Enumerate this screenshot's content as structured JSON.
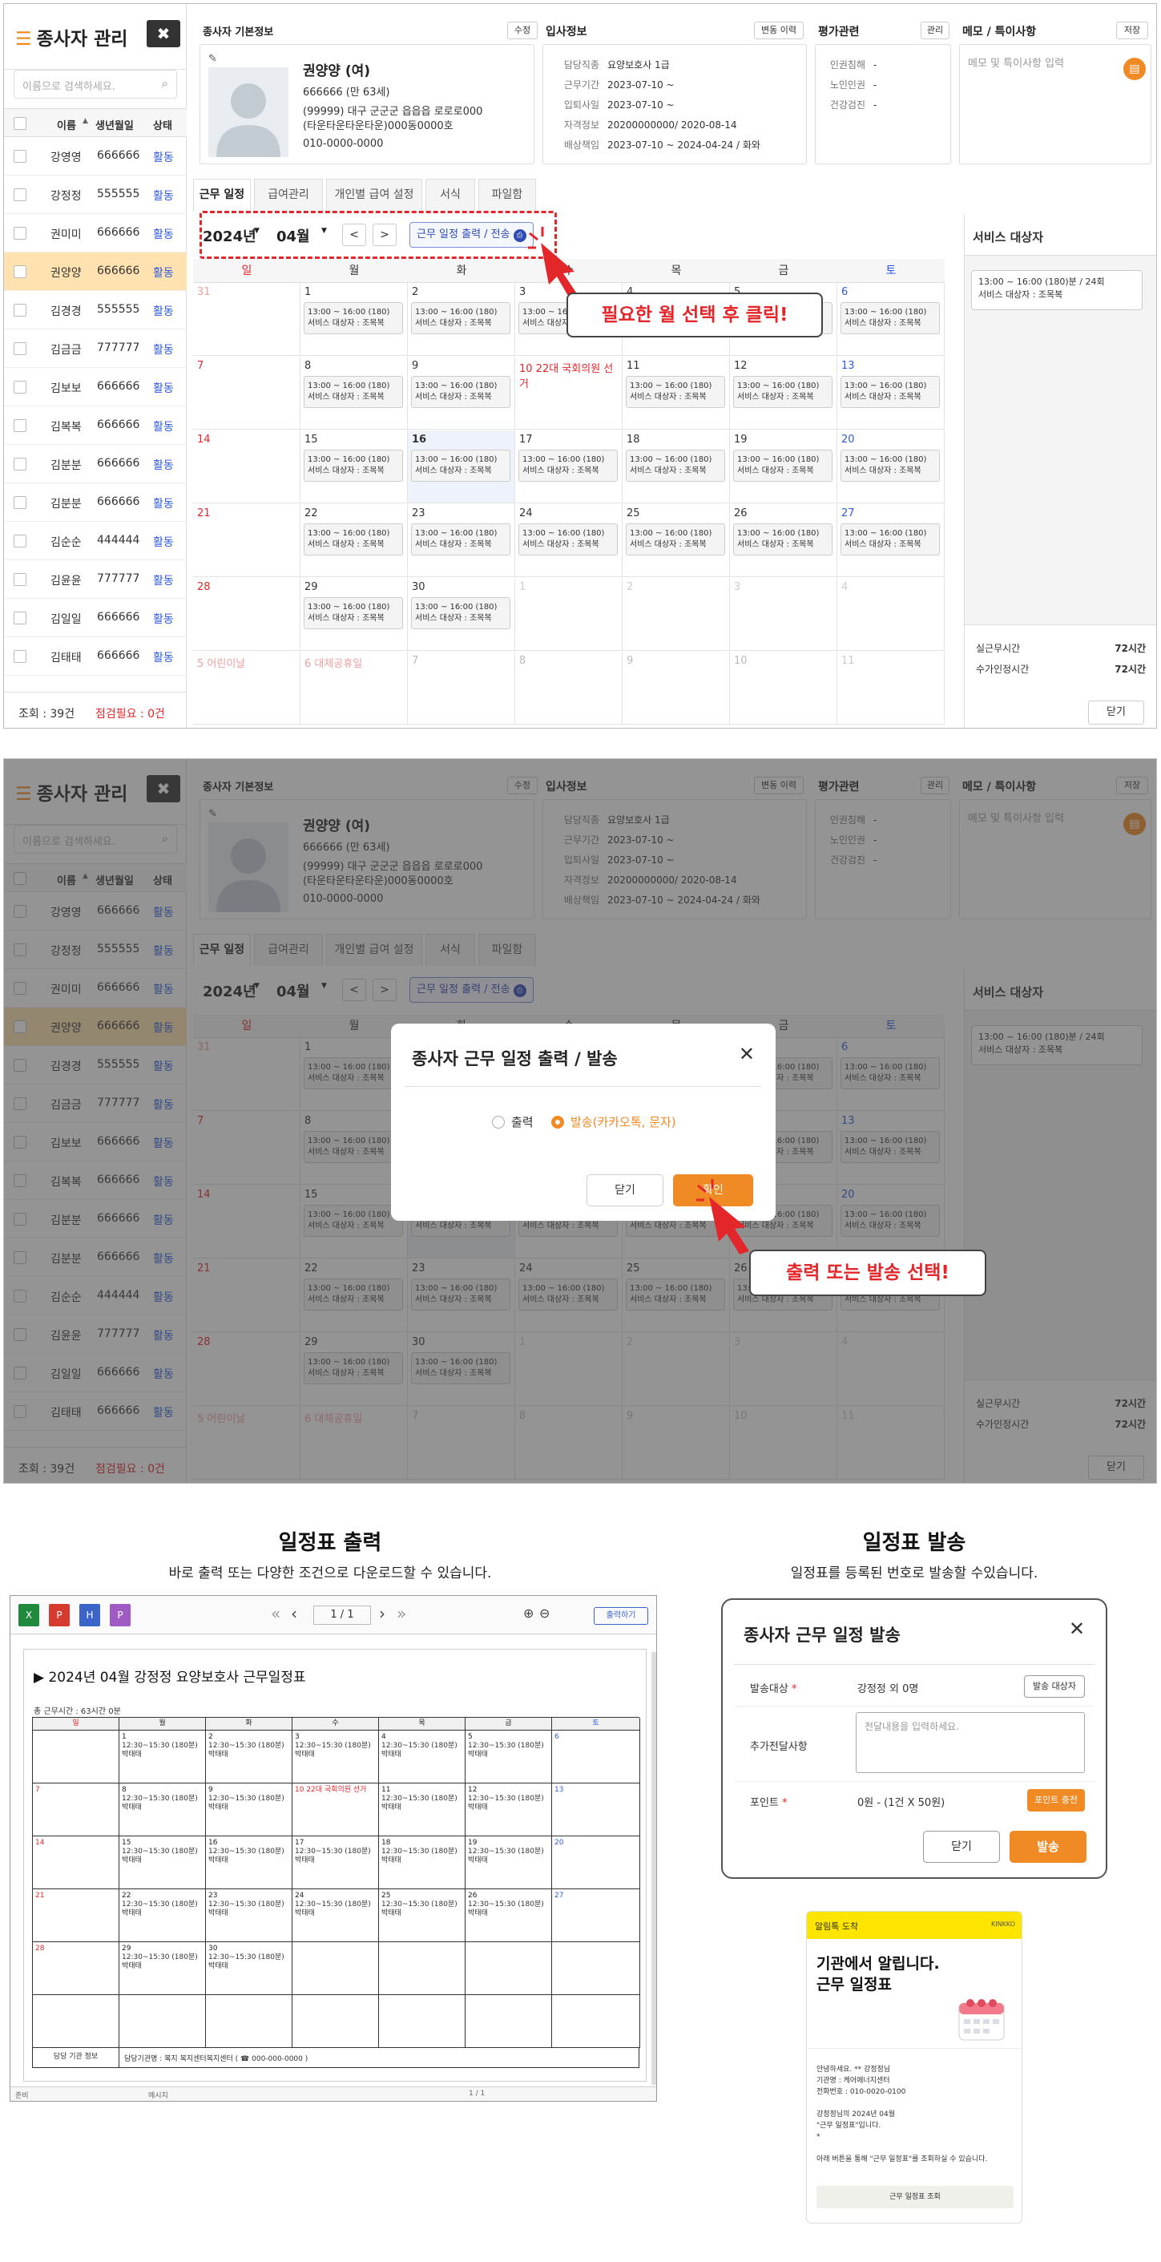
{
  "app": {
    "title": "종사자 관리",
    "close_label": "✖",
    "search_placeholder": "이름으로 검색하세요.",
    "columns": {
      "name": "이름",
      "birth": "생년월일",
      "status": "상태"
    },
    "employees": [
      {
        "name": "강영영",
        "birth": "666666",
        "status": "활동"
      },
      {
        "name": "강정정",
        "birth": "555555",
        "status": "활동"
      },
      {
        "name": "권미미",
        "birth": "666666",
        "status": "활동"
      },
      {
        "name": "권양양",
        "birth": "666666",
        "status": "활동",
        "selected": true
      },
      {
        "name": "김경경",
        "birth": "555555",
        "status": "활동"
      },
      {
        "name": "김금금",
        "birth": "777777",
        "status": "활동"
      },
      {
        "name": "김보보",
        "birth": "666666",
        "status": "활동"
      },
      {
        "name": "김복복",
        "birth": "666666",
        "status": "활동"
      },
      {
        "name": "김분분",
        "birth": "666666",
        "status": "활동"
      },
      {
        "name": "김분분",
        "birth": "666666",
        "status": "활동"
      },
      {
        "name": "김순순",
        "birth": "444444",
        "status": "활동"
      },
      {
        "name": "김윤윤",
        "birth": "777777",
        "status": "활동"
      },
      {
        "name": "김일일",
        "birth": "666666",
        "status": "활동"
      },
      {
        "name": "김태태",
        "birth": "666666",
        "status": "활동"
      }
    ],
    "footer": {
      "total": "조회 : 39건",
      "check": "점검필요 : 0건"
    }
  },
  "profile": {
    "section_title": "종사자 기본정보",
    "edit_label": "수정",
    "name": "권양양 (여)",
    "birth": "666666 (만 63세)",
    "address1": "(99999) 대구 군군군 읍읍읍 로로로000",
    "address2": "(타운타운타운타운)000동0000호",
    "phone": "010-0000-0000"
  },
  "join_info": {
    "section_title": "입사정보",
    "history_label": "변동 이력",
    "rows": [
      {
        "label": "담당직종",
        "value": "요양보호사 1급"
      },
      {
        "label": "근무기간",
        "value": "2023-07-10 ~"
      },
      {
        "label": "입퇴사일",
        "value": "2023-07-10 ~"
      },
      {
        "label": "자격정보",
        "value": "20200000000/ 2020-08-14"
      },
      {
        "label": "배상책임",
        "value": "2023-07-10 ~ 2024-04-24 / 화와"
      }
    ]
  },
  "evaluation": {
    "section_title": "평가관련",
    "manage_label": "관리",
    "rows": [
      {
        "label": "인권침해",
        "value": "-"
      },
      {
        "label": "노인인권",
        "value": "-"
      },
      {
        "label": "건강검진",
        "value": "-"
      }
    ]
  },
  "memo": {
    "section_title": "메모 / 특이사항",
    "save_label": "저장",
    "placeholder": "메모 및 특이사항 입력"
  },
  "tabs": [
    "근무 일정",
    "급여관리",
    "개인별 급여 설정",
    "서식",
    "파일함"
  ],
  "calendar": {
    "year": "2024년",
    "month": "04월",
    "prev": "<",
    "next": ">",
    "print_button": "근무 일정 출력 / 전송",
    "weekdays": [
      "일",
      "월",
      "화",
      "수",
      "목",
      "금",
      "토"
    ],
    "event_line1": "13:00 ~ 16:00 (180)",
    "event_line2": "서비스 대상자 : 조목복",
    "holiday_10": "10 22대 국회의원 선거",
    "holiday_5": "5 어린이날",
    "holiday_6": "6 대체공휴일",
    "rows": [
      [
        "31",
        "1",
        "2",
        "3",
        "4",
        "5",
        "6"
      ],
      [
        "7",
        "8",
        "9",
        "",
        "11",
        "12",
        "13"
      ],
      [
        "14",
        "15",
        "16",
        "17",
        "18",
        "19",
        "20"
      ],
      [
        "21",
        "22",
        "23",
        "24",
        "25",
        "26",
        "27"
      ],
      [
        "28",
        "29",
        "30",
        "1",
        "2",
        "3",
        "4"
      ],
      [
        "",
        "",
        "7",
        "8",
        "9",
        "10",
        "11"
      ]
    ]
  },
  "service_panel": {
    "title": "서비스 대상자",
    "item_line1": "13:00 ~ 16:00 (180)분 / 24회",
    "item_line2": "서비스 대상자 : 조목복",
    "actual_label": "실근무시간",
    "actual_value": "72시간",
    "billing_label": "수가인정시간",
    "billing_value": "72시간",
    "close_label": "닫기"
  },
  "callouts": {
    "step1": "필요한 월 선택 후 클릭!",
    "step2": "출력 또는 발송 선택!"
  },
  "modal": {
    "title": "종사자 근무 일정 출력 / 발송",
    "option_print": "출력",
    "option_send": "발송(카카오톡, 문자)",
    "cancel": "닫기",
    "confirm": "확인"
  },
  "print_section": {
    "title": "일정표 출력",
    "subtitle": "바로 출력 또는 다양한 조건으로 다운로드할 수 있습니다.",
    "page": "1 / 1",
    "print_btn": "출력하기",
    "doc_title": "▶ 2024년 04월 강정정 요양보호사 근무일정표",
    "total_time": "총 근무시간 : 63시간 0분",
    "event_line1": "12:30~15:30 (180분)",
    "event_line2": "박태태",
    "holiday": "10 22대 국회의원 선거",
    "footer_label": "담당 기관 정보",
    "footer_value": "담당기관명 : 복지 복지센터복지센터 ( ☎ 000-000-0000 )",
    "status_left": "준비",
    "status_mid": "메시지",
    "status_page": "1 / 1"
  },
  "send_section": {
    "title": "일정표 발송",
    "subtitle": "일정표를 등록된 번호로 발송할 수있습니다.",
    "modal_title": "종사자 근무 일정 발송",
    "target_label": "발송대상",
    "target_value": "강정정 외 0명",
    "target_btn": "발송 대상자",
    "extra_label": "추가전달사항",
    "extra_placeholder": "전달내용을 입력하세요.",
    "point_label": "포인트",
    "point_value": "0원 - (1건 X 50원)",
    "point_btn": "포인트 충전",
    "cancel": "닫기",
    "send": "발송"
  },
  "kakao": {
    "header": "알림톡 도착",
    "brand": "KINKKO",
    "headline1": "기관에서 알립니다.",
    "headline2": "근무 일정표",
    "line1": "안녕하세요. ** 강정정님",
    "line2": "기관명 : 케어에너지센터",
    "line3": "전화번호 : 010-0020-0100",
    "line4": "강정정님의 2024년 04월",
    "line5": "\"근무 일정표\"입니다.",
    "line6": "*",
    "line7": "아래 버튼을 통해 \"근무 일정표\"를 조회하실 수 있습니다.",
    "button": "근무 일정표 조회"
  },
  "colors": {
    "accent": "#f08a24",
    "link": "#2f5bdb",
    "danger": "#e3262a"
  }
}
